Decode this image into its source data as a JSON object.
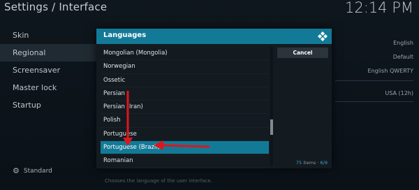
{
  "header": {
    "title": "Settings / Interface",
    "clock": "12:14 PM"
  },
  "sidebar": {
    "items": [
      {
        "label": "Skin"
      },
      {
        "label": "Regional"
      },
      {
        "label": "Screensaver"
      },
      {
        "label": "Master lock"
      },
      {
        "label": "Startup"
      }
    ],
    "active_index": 1,
    "level_label": "Standard"
  },
  "background_values": [
    "English",
    "Default",
    "English QWERTY",
    "USA (12h)"
  ],
  "footer_hint": "Chooses the language of the user interface.",
  "dialog": {
    "title": "Languages",
    "cancel_label": "Cancel",
    "items": [
      "Mongolian (Mongolia)",
      "Norwegian",
      "Ossetic",
      "Persian",
      "Persian (Iran)",
      "Polish",
      "Portuguese",
      "Portuguese (Brazil)",
      "Romanian"
    ],
    "selected_index": 7,
    "count_number": "75",
    "count_text": " items · ",
    "page": "6/9"
  },
  "colors": {
    "accent": "#127a97",
    "arrow": "#e0141c"
  }
}
